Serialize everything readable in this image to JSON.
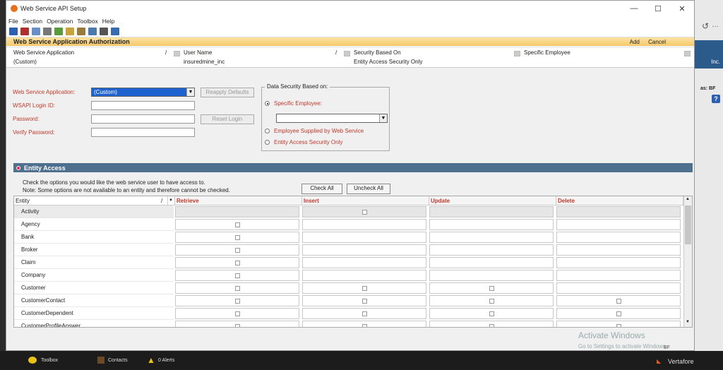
{
  "window": {
    "title": "Web Service API Setup",
    "min": "—",
    "max": "☐",
    "close": "✕"
  },
  "menu": [
    "File",
    "Section",
    "Operation",
    "Toolbox",
    "Help"
  ],
  "banner": {
    "title": "Web Service Application Authorization",
    "add": "Add",
    "cancel": "Cancel"
  },
  "summary": {
    "app_label": "Web Service Application",
    "app_value": "(Custom)",
    "user_label": "User Name",
    "user_value": "insuredmine_inc",
    "security_label": "Security Based On",
    "security_value": "Entity Access Security Only",
    "employee_label": "Specific Employee",
    "employee_value": ""
  },
  "form": {
    "app_label": "Web Service Application:",
    "app_value": "(Custom)",
    "login_label": "WSAPI Login ID:",
    "password_label": "Password:",
    "verify_label": "Verify Password:",
    "reapply": "Reapply Defaults",
    "reset": "Reset Login"
  },
  "security_group": {
    "legend": "Data Security Based on:",
    "opt1": "Specific Employee:",
    "opt2": "Employee Supplied by Web Service",
    "opt3": "Entity Access Security Only"
  },
  "entity_access": {
    "title": "Entity Access",
    "note1": "Check the options you would like the web service user to have access to.",
    "note2": "Note:  Some options are not available to an entity and therefore cannot be checked.",
    "check_all": "Check All",
    "uncheck_all": "Uncheck All",
    "columns": [
      "Entity",
      "Retrieve",
      "Insert",
      "Update",
      "Delete"
    ],
    "rows": [
      {
        "name": "Activity",
        "r": false,
        "i": true,
        "u": false,
        "d": false
      },
      {
        "name": "Agency",
        "r": true,
        "i": false,
        "u": false,
        "d": false
      },
      {
        "name": "Bank",
        "r": true,
        "i": false,
        "u": false,
        "d": false
      },
      {
        "name": "Broker",
        "r": true,
        "i": false,
        "u": false,
        "d": false
      },
      {
        "name": "Claim",
        "r": true,
        "i": false,
        "u": false,
        "d": false
      },
      {
        "name": "Company",
        "r": true,
        "i": false,
        "u": false,
        "d": false
      },
      {
        "name": "Customer",
        "r": true,
        "i": true,
        "u": true,
        "d": false
      },
      {
        "name": "CustomerContact",
        "r": true,
        "i": true,
        "u": true,
        "d": true
      },
      {
        "name": "CustomerDependent",
        "r": true,
        "i": true,
        "u": true,
        "d": true
      },
      {
        "name": "CustomerProfileAnswer",
        "r": true,
        "i": true,
        "u": true,
        "d": true
      }
    ]
  },
  "watermark": {
    "line1": "Activate Windows",
    "line2": "Go to Settings to activate Windows."
  },
  "taskbar": {
    "toolbox": "Toolbox",
    "contacts": "Contacts",
    "alerts": "0 Alerts",
    "brand": "Vertafore",
    "bf": "BF"
  },
  "right_strip": {
    "inc": "Inc.",
    "as_bf": "as: BF"
  }
}
